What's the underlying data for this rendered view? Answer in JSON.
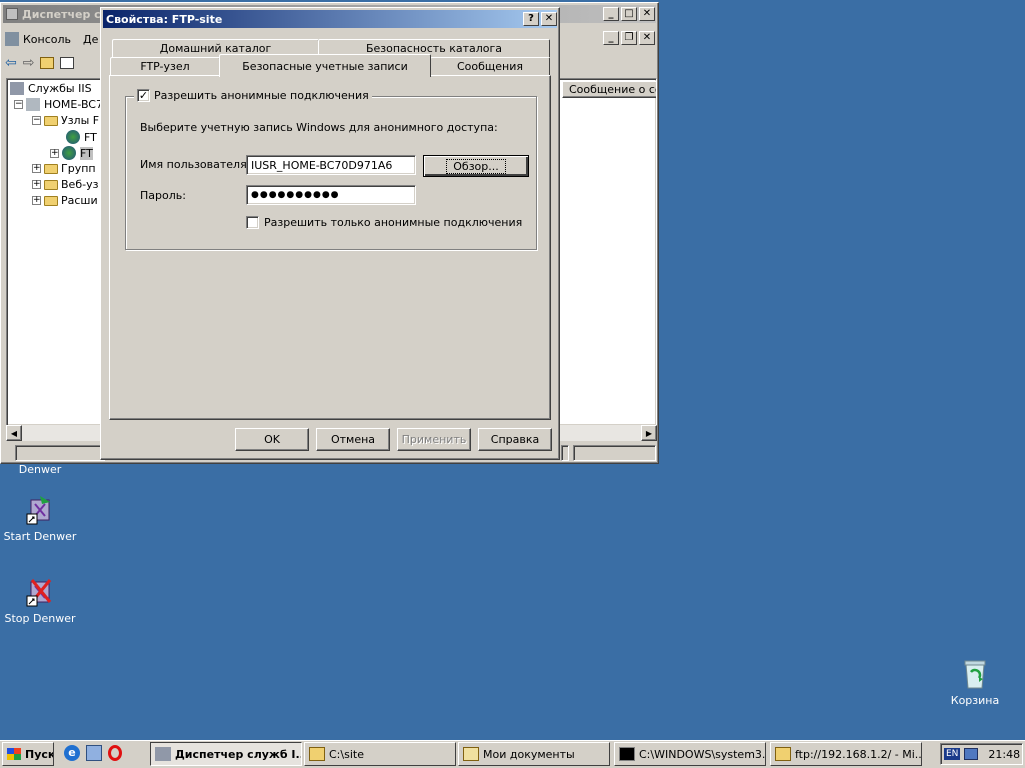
{
  "main_window": {
    "title": "Диспетчер с",
    "menu": {
      "console": "Консоль",
      "action": "Де"
    },
    "list_header": "Сообщение о сос",
    "tree": [
      {
        "label": "Службы IIS"
      },
      {
        "label": "HOME-BC7"
      },
      {
        "label": "Узлы F"
      },
      {
        "label": "FT"
      },
      {
        "label": "FT"
      },
      {
        "label": "Групп"
      },
      {
        "label": "Веб-уз"
      },
      {
        "label": "Расши"
      }
    ]
  },
  "dialog": {
    "title": "Свойства: FTP-site",
    "help_btn": "?",
    "close_btn": "✕",
    "tabs_row1": [
      "Домашний каталог",
      "Безопасность каталога"
    ],
    "tabs_row2": [
      "FTP-узел",
      "Безопасные учетные записи",
      "Сообщения"
    ],
    "allow_anon_label": "Разрешить анонимные подключения",
    "choose_account_text": "Выберите учетную запись Windows для анонимного доступа:",
    "username_label": "Имя пользователя:",
    "username_value": "IUSR_HOME-BC70D971A6",
    "browse_button": "Обзор...",
    "password_label": "Пароль:",
    "password_value": "●●●●●●●●●●",
    "only_anon_label": "Разрешить только анонимные подключения",
    "ok": "OK",
    "cancel": "Отмена",
    "apply": "Применить",
    "help": "Справка"
  },
  "desktop": {
    "icons": [
      {
        "label": "Denwer"
      },
      {
        "label": "Start Denwer"
      },
      {
        "label": "Stop Denwer"
      },
      {
        "label": "Корзина"
      }
    ]
  },
  "taskbar": {
    "start": "Пуск",
    "tasks": [
      {
        "label": "Диспетчер служб I..."
      },
      {
        "label": "C:\\site"
      },
      {
        "label": "Мои документы"
      },
      {
        "label": "C:\\WINDOWS\\system3..."
      },
      {
        "label": "ftp://192.168.1.2/ - Mi..."
      }
    ],
    "lang": "EN",
    "clock": "21:48"
  },
  "colors": {
    "desktop": "#3a6ea5",
    "face": "#d4d0c8",
    "title_active": "#0a246a"
  }
}
